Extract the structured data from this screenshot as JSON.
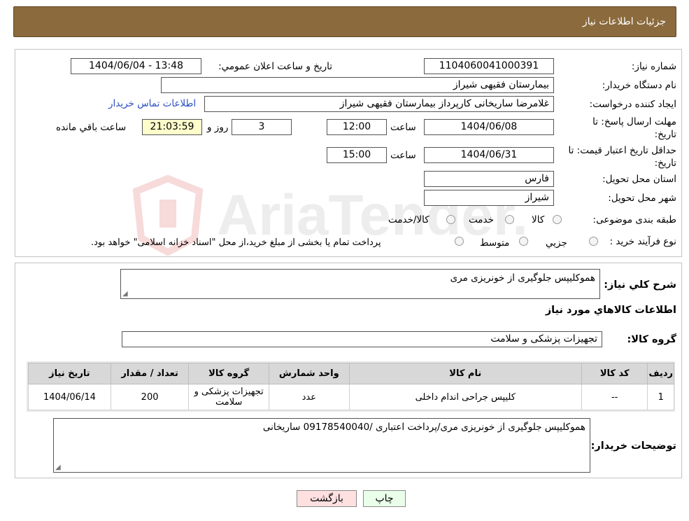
{
  "header": {
    "title": "جزئیات اطلاعات نیاز"
  },
  "form": {
    "need_number_label": "شماره نیاز:",
    "need_number": "1104060041000391",
    "announce_label": "تاریخ و ساعت اعلان عمومي:",
    "announce_value": "1404/06/04 - 13:48",
    "buyer_org_label": "نام دستگاه خريدار:",
    "buyer_org": "بیمارستان فقیهی شیراز",
    "creator_label": "ایجاد کننده درخواست:",
    "creator": "غلامرضا ساریخانی کارپرداز بیمارستان فقیهی شیراز",
    "contact_link": "اطلاعات تماس خریدار",
    "deadline_label_1": "مهلت ارسال پاسخ: تا",
    "deadline_label_2": "تاریخ:",
    "deadline_date": "1404/06/08",
    "time_word": "ساعت",
    "deadline_time": "12:00",
    "days_value": "3",
    "days_word": "روز و",
    "remaining_time": "21:03:59",
    "remaining_word": "ساعت باقي مانده",
    "validity_label_1": "حداقل تاريخ اعتبار قيمت: تا",
    "validity_label_2": "تاريخ:",
    "validity_date": "1404/06/31",
    "validity_time": "15:00",
    "province_label": "استان محل تحویل:",
    "province": "فارس",
    "city_label": "شهر محل تحویل:",
    "city": "شیراز",
    "category_label": "طبقه بندی موضوعی:",
    "category_options": [
      "کالا",
      "خدمت",
      "کالا/خدمت"
    ],
    "process_label": "نوع فرآیند خرید :",
    "process_options": [
      "جزیي",
      "متوسط"
    ],
    "process_note": "پرداخت تمام يا بخشی از مبلغ خريد،از محل \"اسناد خزانه اسلامی\" خواهد بود."
  },
  "summary": {
    "desc_label": "شرح كلي نياز:",
    "desc_value": "هموکلیپس جلوگیری از خونریزی مری",
    "items_title": "اطلاعات كالاهاي مورد نياز",
    "group_label": "گروه کالا:",
    "group_value": "تجهیزات پزشکی و سلامت",
    "table_headers": [
      "رديف",
      "کد کالا",
      "نام کالا",
      "واحد شمارش",
      "گروه کالا",
      "تعداد / مقدار",
      "تاریخ نیاز"
    ],
    "table_rows": [
      [
        "1",
        "--",
        "کلیپس جراحی اندام داخلی",
        "عدد",
        "تجهیزات پزشکی و سلامت",
        "200",
        "1404/06/14"
      ]
    ],
    "buyer_notes_label": "توضیحات خریدار:",
    "buyer_notes": "هموکلیپس جلوگیری از خونریزی مری/پرداخت اعتباری /09178540040 ساریخانی"
  },
  "buttons": {
    "print": "چاپ",
    "back": "بازگشت"
  },
  "colors": {
    "header": "#8b6a3d",
    "link": "#2a4fbf",
    "yellow": "#ffffcc",
    "back_button": "#ffe0e0",
    "print_button": "#eaffea"
  }
}
